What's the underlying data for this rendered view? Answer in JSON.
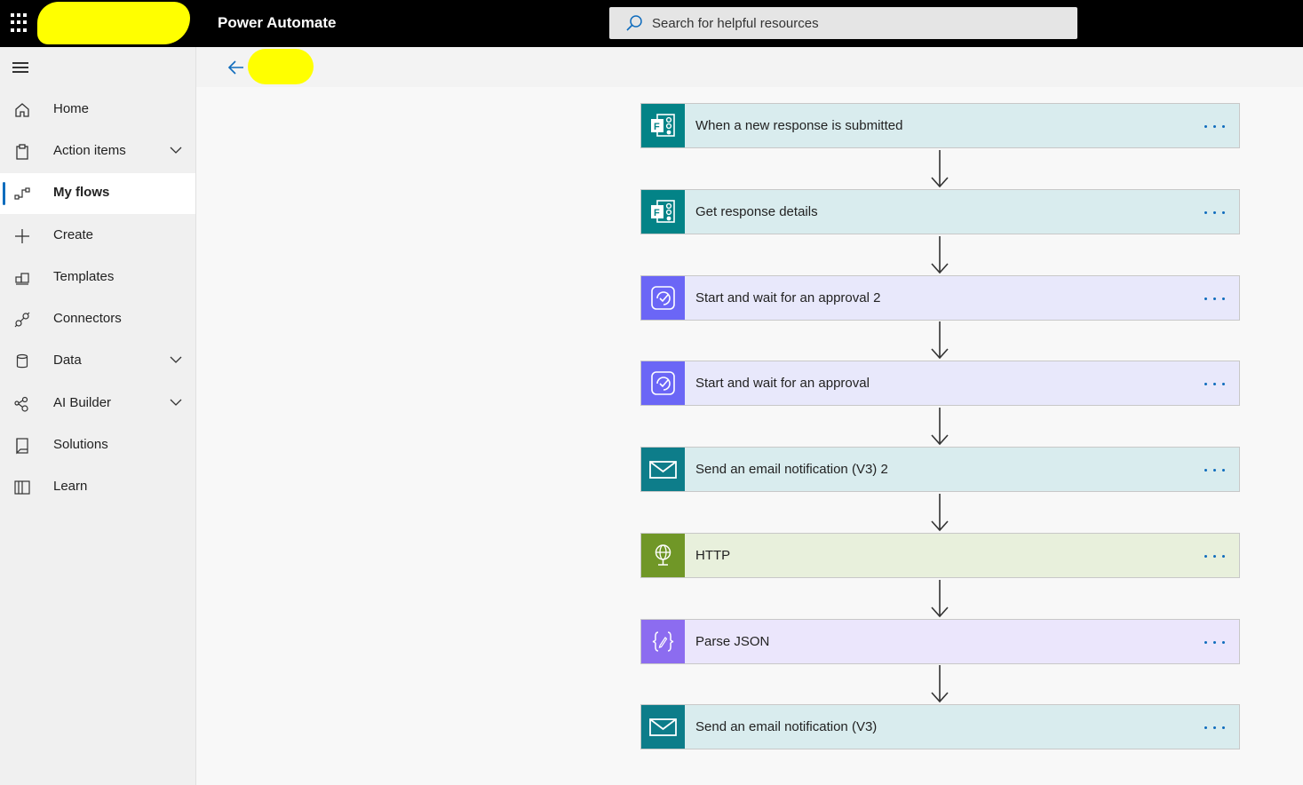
{
  "topbar": {
    "app_title": "Power Automate",
    "search_placeholder": "Search for helpful resources",
    "account_name_redacted": true
  },
  "sidebar": {
    "items": [
      {
        "label": "Home",
        "icon": "home-icon",
        "expandable": false,
        "active": false
      },
      {
        "label": "Action items",
        "icon": "clipboard-icon",
        "expandable": true,
        "active": false
      },
      {
        "label": "My flows",
        "icon": "flows-icon",
        "expandable": false,
        "active": true
      },
      {
        "label": "Create",
        "icon": "plus-icon",
        "expandable": false,
        "active": false
      },
      {
        "label": "Templates",
        "icon": "templates-icon",
        "expandable": false,
        "active": false
      },
      {
        "label": "Connectors",
        "icon": "plug-icon",
        "expandable": false,
        "active": false
      },
      {
        "label": "Data",
        "icon": "database-icon",
        "expandable": true,
        "active": false
      },
      {
        "label": "AI Builder",
        "icon": "ai-builder-icon",
        "expandable": true,
        "active": false
      },
      {
        "label": "Solutions",
        "icon": "solutions-icon",
        "expandable": false,
        "active": false
      },
      {
        "label": "Learn",
        "icon": "book-icon",
        "expandable": false,
        "active": false
      }
    ]
  },
  "flow": {
    "steps": [
      {
        "title": "When a new response is submitted",
        "connector": "forms",
        "icon": "forms-icon",
        "icon_bg": "#038387",
        "card_bg": "#d9ecee"
      },
      {
        "title": "Get response details",
        "connector": "forms",
        "icon": "forms-icon",
        "icon_bg": "#038387",
        "card_bg": "#d9ecee"
      },
      {
        "title": "Start and wait for an approval 2",
        "connector": "approvals",
        "icon": "approval-icon",
        "icon_bg": "#6b66f6",
        "card_bg": "#e8e8fb"
      },
      {
        "title": "Start and wait for an approval",
        "connector": "approvals",
        "icon": "approval-icon",
        "icon_bg": "#6b66f6",
        "card_bg": "#e8e8fb"
      },
      {
        "title": "Send an email notification (V3) 2",
        "connector": "mail",
        "icon": "mail-icon",
        "icon_bg": "#0d7d8a",
        "card_bg": "#d9ecee"
      },
      {
        "title": "HTTP",
        "connector": "http",
        "icon": "globe-icon",
        "icon_bg": "#709727",
        "card_bg": "#e8f0dc"
      },
      {
        "title": "Parse JSON",
        "connector": "data-operations",
        "icon": "braces-icon",
        "icon_bg": "#8c6cf0",
        "card_bg": "#ebe6fc"
      },
      {
        "title": "Send an email notification (V3)",
        "connector": "mail",
        "icon": "mail-icon",
        "icon_bg": "#0d7d8a",
        "card_bg": "#d9ecee"
      }
    ]
  },
  "colors": {
    "accent": "#0f6cbd",
    "topbar_bg": "#000000"
  }
}
